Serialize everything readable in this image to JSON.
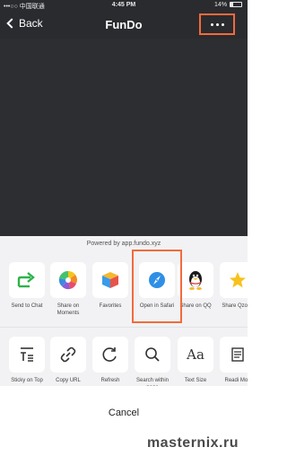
{
  "status_bar": {
    "carrier": "•••○○ 中国联通",
    "time": "4:45 PM",
    "battery": "14%"
  },
  "nav": {
    "back_label": "Back",
    "title": "FunDo"
  },
  "sheet": {
    "powered_by": "Powered by app.fundo.xyz",
    "share_row": [
      {
        "label": "Send to Chat",
        "icon": "send-to-chat-icon"
      },
      {
        "label": "Share on Moments",
        "icon": "moments-icon"
      },
      {
        "label": "Favorites",
        "icon": "favorites-cube-icon"
      },
      {
        "label": "Open in Safari",
        "icon": "safari-compass-icon"
      },
      {
        "label": "Share on QQ",
        "icon": "qq-penguin-icon"
      },
      {
        "label": "Share Qzone",
        "icon": "qzone-star-icon"
      }
    ],
    "action_row": [
      {
        "label": "Sticky on Top",
        "icon": "sticky-top-icon"
      },
      {
        "label": "Copy URL",
        "icon": "link-icon"
      },
      {
        "label": "Refresh",
        "icon": "refresh-icon"
      },
      {
        "label": "Search within page",
        "icon": "search-icon"
      },
      {
        "label": "Text Size",
        "icon": "text-size-icon"
      },
      {
        "label": "Readi Mod",
        "icon": "reader-mode-icon"
      }
    ],
    "cancel_label": "Cancel"
  },
  "watermark": "masternix.ru",
  "colors": {
    "highlight": "#f26a3c",
    "navbar": "#2a2b2f",
    "sheet_bg": "#f2f2f4"
  }
}
